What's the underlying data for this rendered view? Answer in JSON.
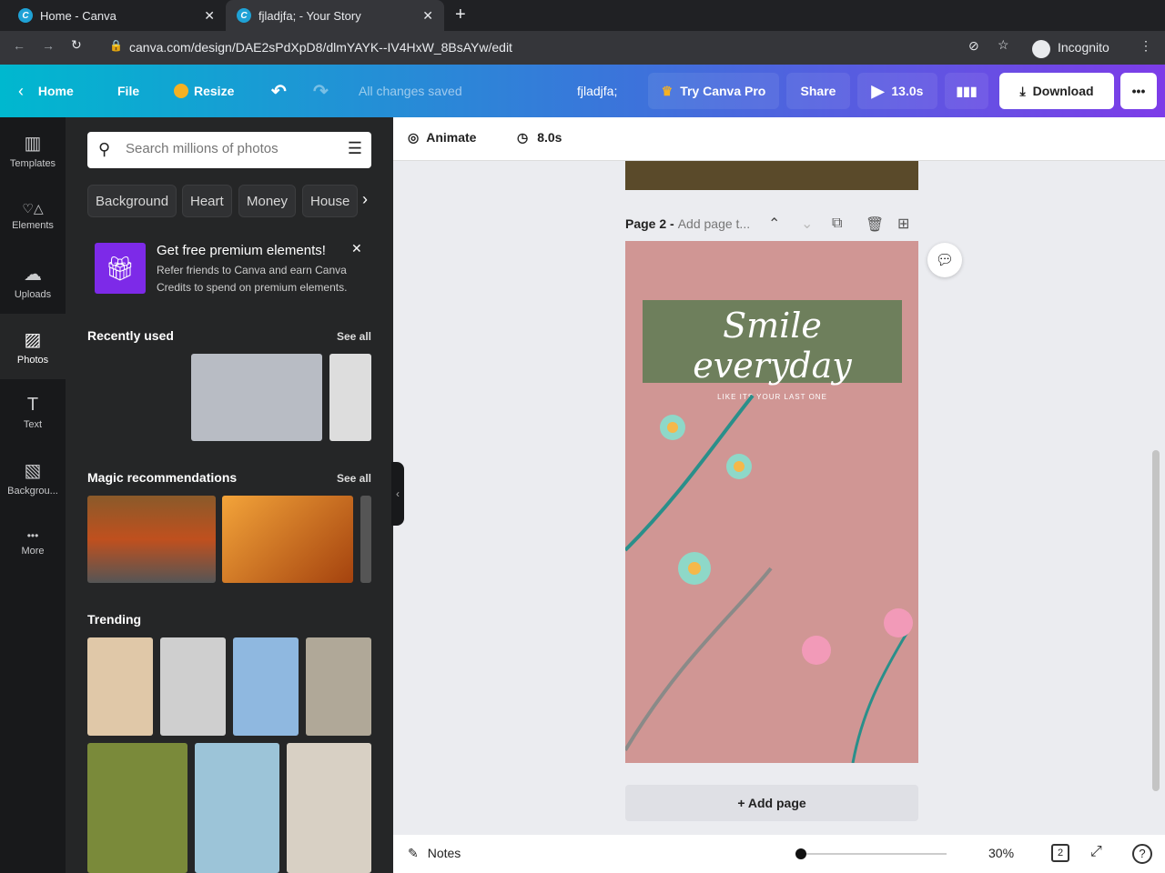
{
  "browser": {
    "tabs": [
      {
        "title": "Home - Canva"
      },
      {
        "title": "fjladjfa; - Your Story"
      }
    ],
    "url": "canva.com/design/DAE2sPdXpD8/dlmYAYK--IV4HxW_8BsAYw/edit",
    "profile": "Incognito"
  },
  "topbar": {
    "home": "Home",
    "file": "File",
    "resize": "Resize",
    "status": "All changes saved",
    "title": "fjladjfa;",
    "try_pro": "Try Canva Pro",
    "share": "Share",
    "duration": "13.0s",
    "download": "Download",
    "more": "•••"
  },
  "rail": [
    {
      "label": "Templates",
      "icon": "▥"
    },
    {
      "label": "Elements",
      "icon": "♡△"
    },
    {
      "label": "Uploads",
      "icon": "☁"
    },
    {
      "label": "Photos",
      "icon": "▨"
    },
    {
      "label": "Text",
      "icon": "T"
    },
    {
      "label": "Backgrou...",
      "icon": "▧"
    },
    {
      "label": "More",
      "icon": "•••"
    }
  ],
  "panel": {
    "search_placeholder": "Search millions of photos",
    "chips": [
      "Background",
      "Heart",
      "Money",
      "House"
    ],
    "promo": {
      "title": "Get free premium elements!",
      "body": "Refer friends to Canva and earn Canva Credits to spend on premium elements."
    },
    "recent": "Recently used",
    "magic": "Magic recommendations",
    "trending": "Trending",
    "see_all": "See all"
  },
  "canvas": {
    "animate": "Animate",
    "page_duration": "8.0s",
    "page_label": "Page 2 -",
    "page_title_placeholder": "Add page t...",
    "headline": "Smile everyday",
    "subline": "LIKE ITS YOUR LAST ONE",
    "add_page": "+ Add page"
  },
  "footer": {
    "notes": "Notes",
    "zoom": "30%",
    "zoom_fraction": 0.0,
    "page_count": "2"
  },
  "colors": {
    "accent": "#7d2ae8",
    "page_bg": "#d09694",
    "banner": "#6e7f5c"
  }
}
